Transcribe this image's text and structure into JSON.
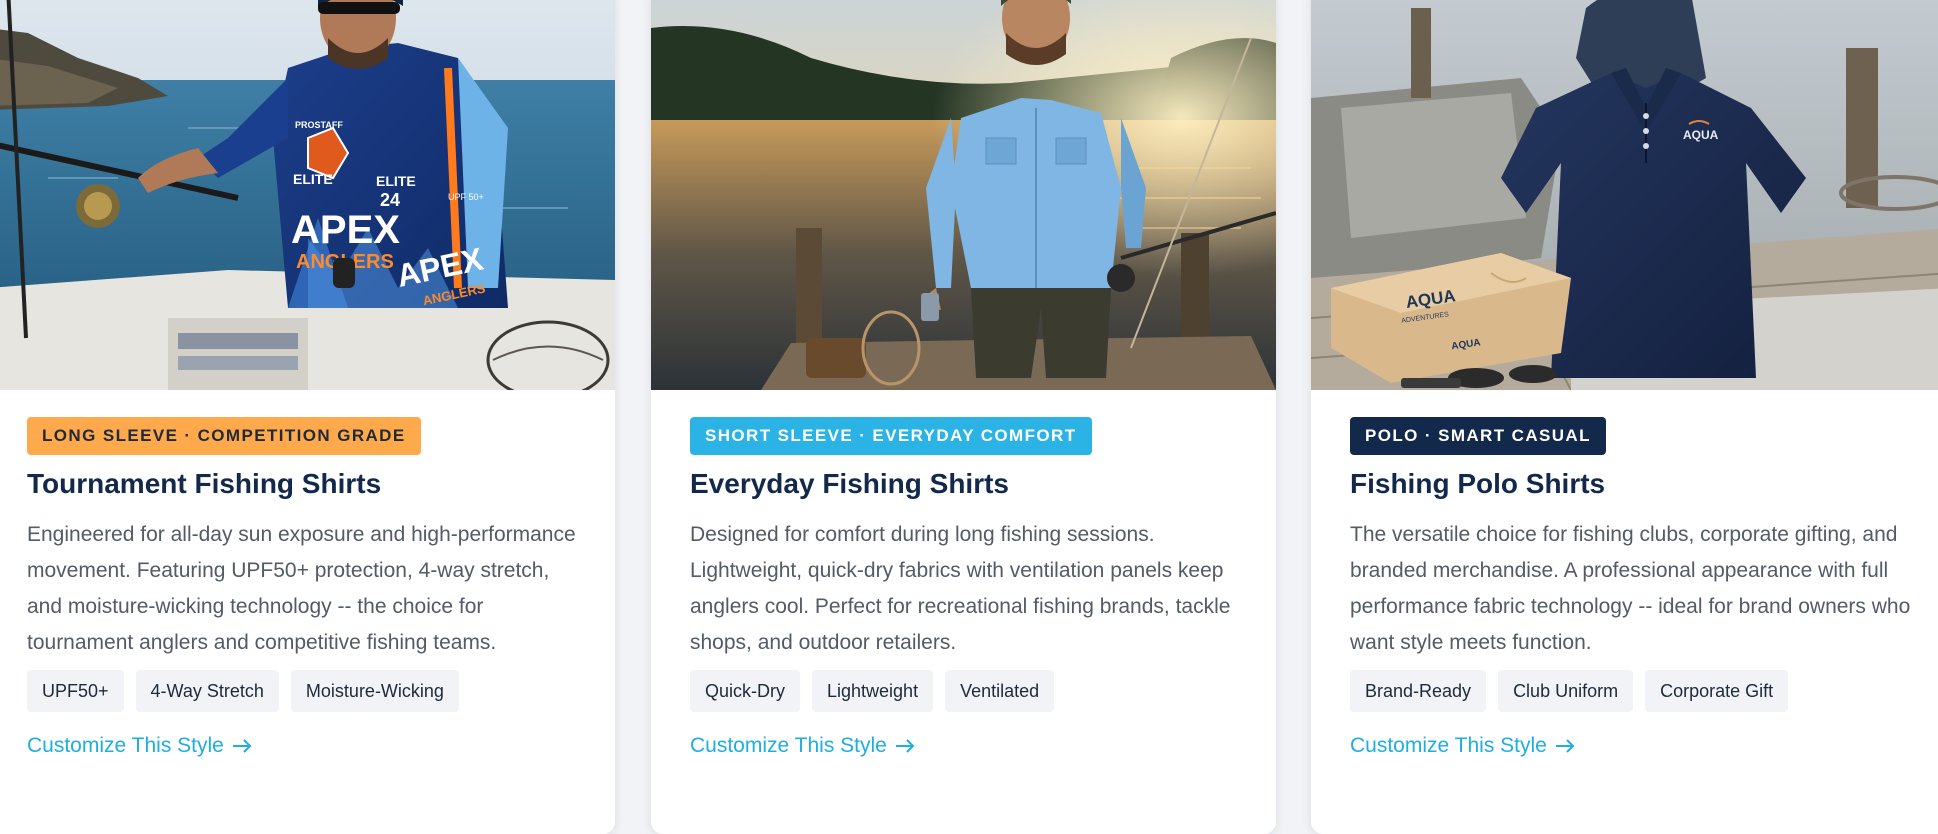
{
  "products": [
    {
      "badge": "LONG SLEEVE · COMPETITION GRADE",
      "badge_bg": "#ffa94d",
      "badge_fg": "#1f2a36",
      "title": "Tournament Fishing Shirts",
      "description": "Engineered for all-day sun exposure and high-performance movement. Featuring UPF50+ protection, 4-way stretch, and moisture-wicking technology -- the choice for tournament anglers and competitive fishing teams.",
      "tags": [
        "UPF50+",
        "4-Way Stretch",
        "Moisture-Wicking"
      ],
      "cta": "Customize This Style",
      "image_text": {
        "chest_logo": "PROSTAFF",
        "elite": "ELITE",
        "number": "24",
        "brand": "APEX",
        "brand_sub": "ANGLERS",
        "upf": "UPF 50+"
      }
    },
    {
      "badge": "SHORT SLEEVE · EVERYDAY COMFORT",
      "badge_bg": "#2bb3e6",
      "badge_fg": "#ffffff",
      "title": "Everyday Fishing Shirts",
      "description": "Designed for comfort during long fishing sessions. Lightweight, quick-dry fabrics with ventilation panels keep anglers cool. Perfect for recreational fishing brands, tackle shops, and outdoor retailers.",
      "tags": [
        "Quick-Dry",
        "Lightweight",
        "Ventilated"
      ],
      "cta": "Customize This Style"
    },
    {
      "badge": "POLO · SMART CASUAL",
      "badge_bg": "#13294b",
      "badge_fg": "#ffffff",
      "title": "Fishing Polo Shirts",
      "description": "The versatile choice for fishing clubs, corporate gifting, and branded merchandise. A professional appearance with full performance fabric technology -- ideal for brand owners who want style meets function.",
      "tags": [
        "Brand-Ready",
        "Club Uniform",
        "Corporate Gift"
      ],
      "cta": "Customize This Style",
      "image_text": {
        "polo_logo": "AQUA",
        "box_logo": "AQUA",
        "box_sub": "ADVENTURES"
      }
    }
  ],
  "colors": {
    "title": "#13294b",
    "body_text": "#525b66",
    "link": "#1eaee0",
    "tag_bg": "#f1f3f7"
  },
  "icons": {
    "cta_arrow": "arrow-right-icon"
  }
}
